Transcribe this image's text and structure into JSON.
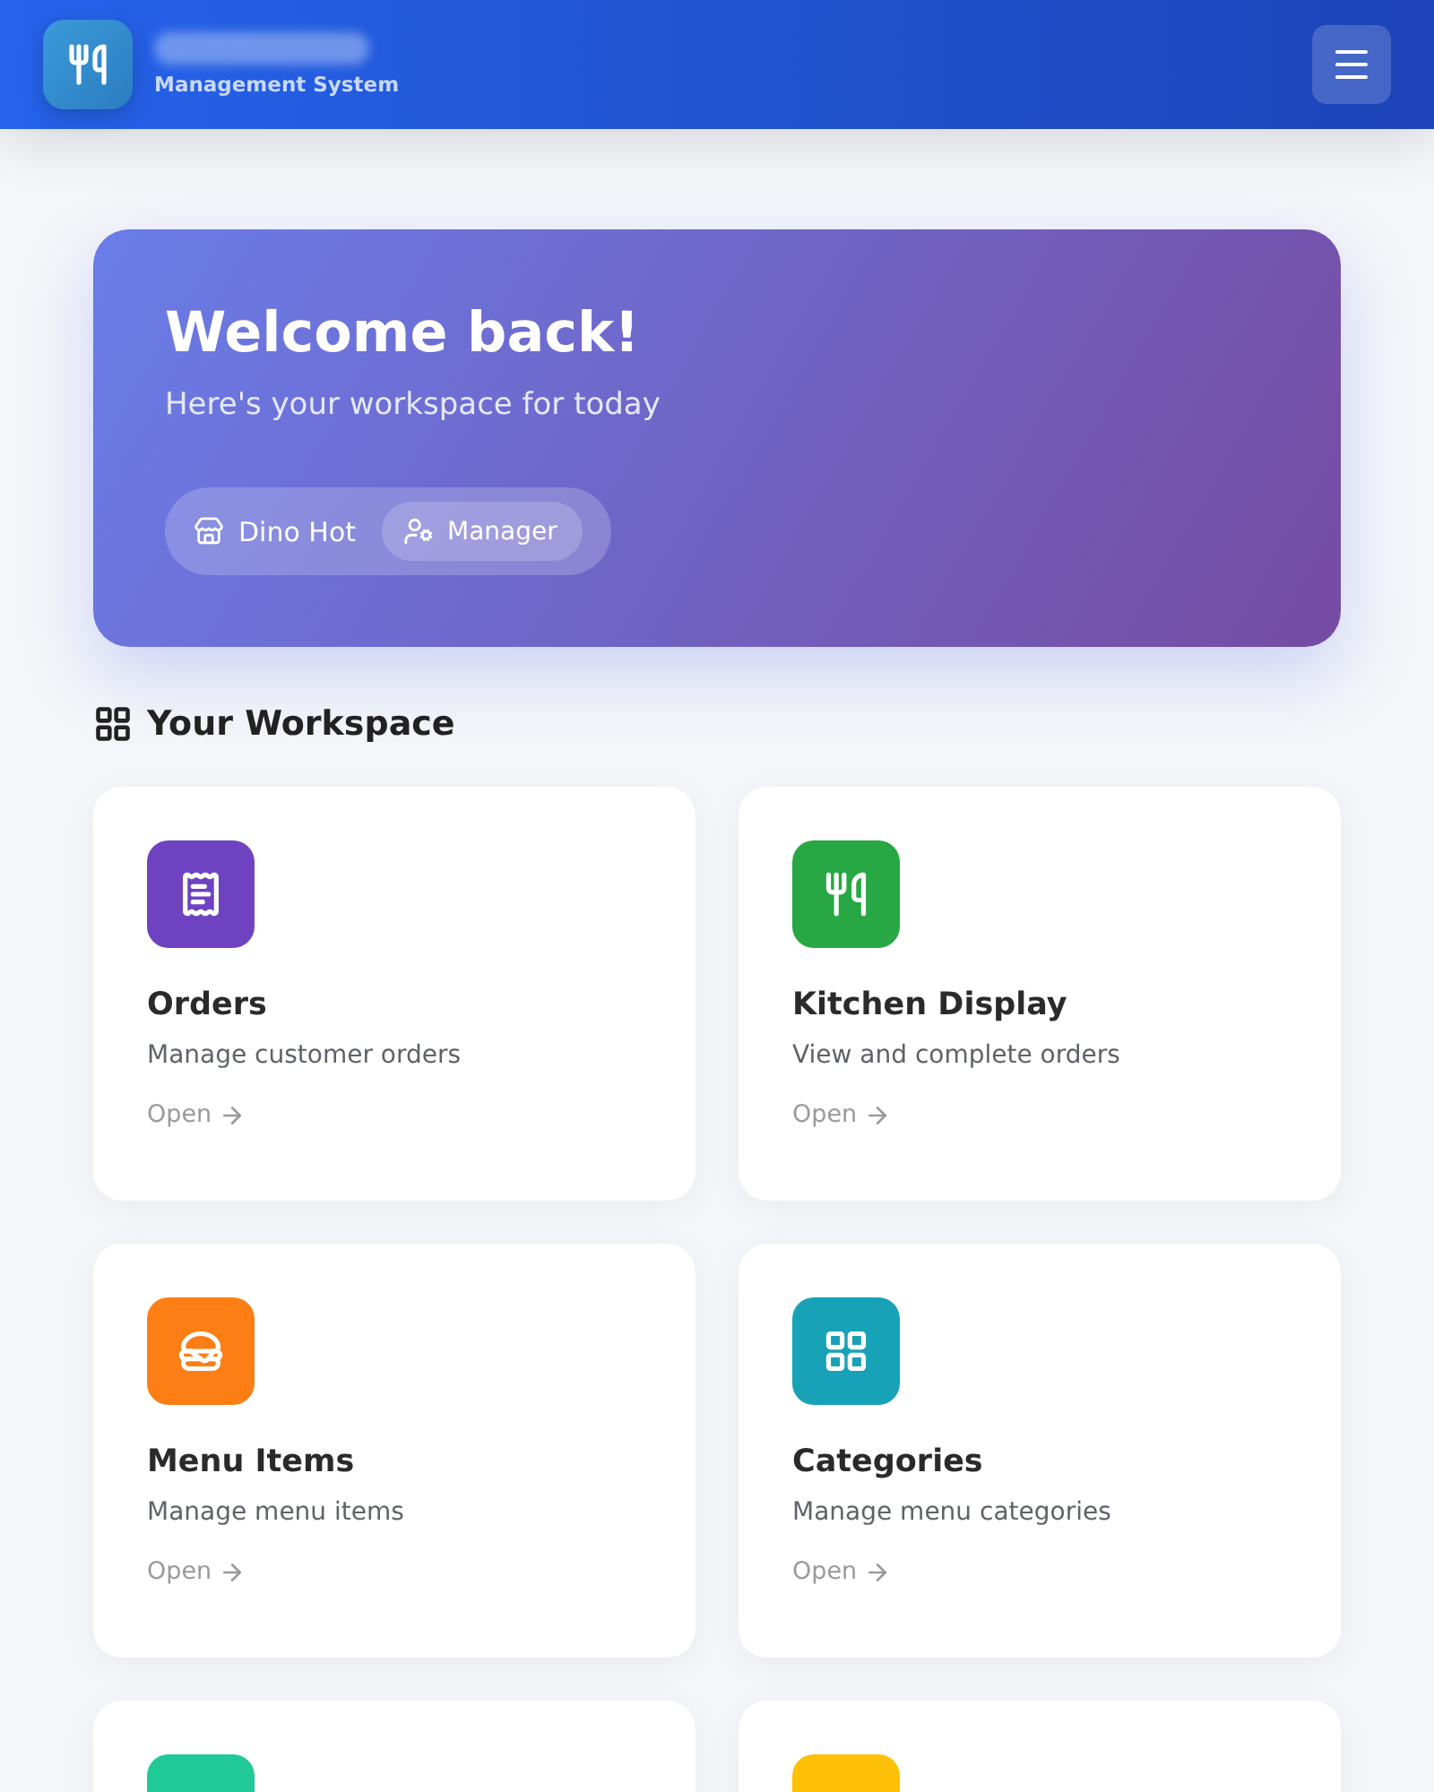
{
  "header": {
    "subtitle": "Management System"
  },
  "hero": {
    "title": "Welcome back!",
    "subtitle": "Here's your workspace for today",
    "restaurant": "Dino Hot",
    "role": "Manager"
  },
  "section": {
    "title": "Your Workspace"
  },
  "cards": [
    {
      "kind": "receipt",
      "color": "#6f42c1",
      "title": "Orders",
      "description": "Manage customer orders",
      "link": "Open"
    },
    {
      "kind": "utensils",
      "color": "#28a745",
      "title": "Kitchen Display",
      "description": "View and complete orders",
      "link": "Open"
    },
    {
      "kind": "burger",
      "color": "#fd7e14",
      "title": "Menu Items",
      "description": "Manage menu items",
      "link": "Open"
    },
    {
      "kind": "grid",
      "color": "#17a2b8",
      "title": "Categories",
      "description": "Manage menu categories",
      "link": "Open"
    },
    {
      "kind": "hidden",
      "color": "#20c997"
    },
    {
      "kind": "hidden",
      "color": "#ffc107"
    }
  ]
}
